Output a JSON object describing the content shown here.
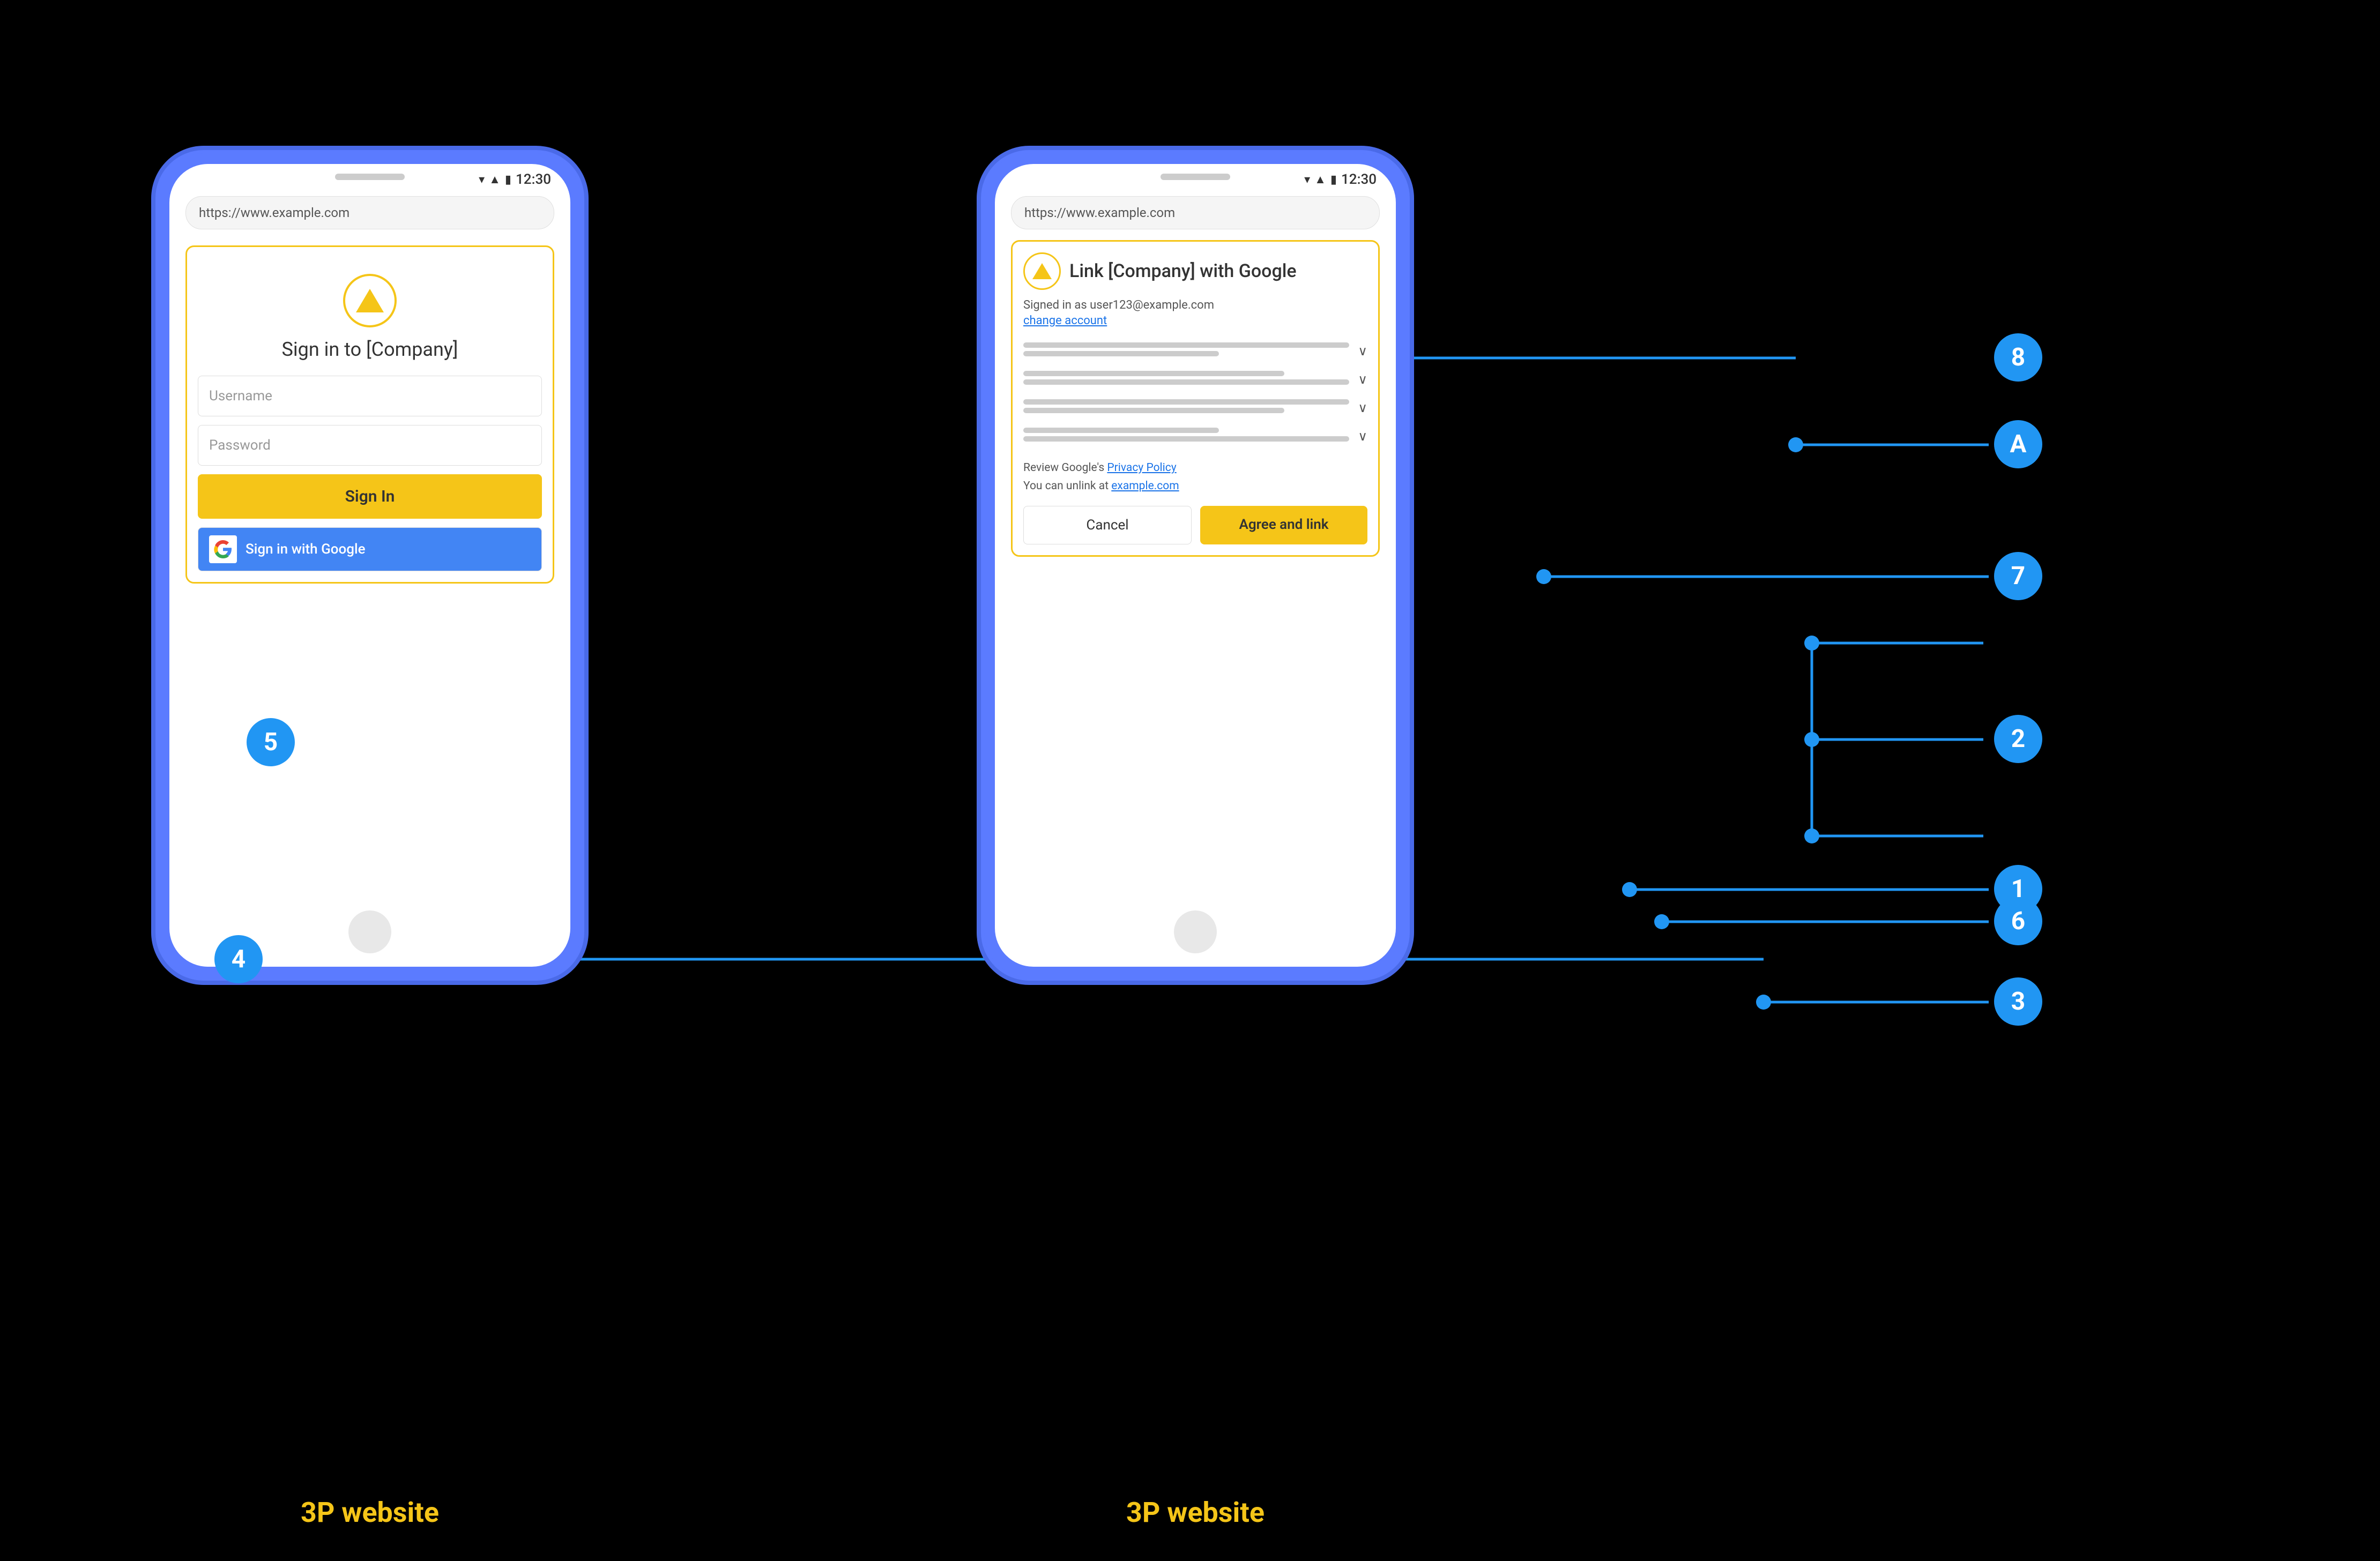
{
  "phone1": {
    "label": "3P website",
    "status": {
      "time": "12:30"
    },
    "url": "https://www.example.com",
    "logo_alt": "company logo triangle",
    "title": "Sign in to [Company]",
    "username_placeholder": "Username",
    "password_placeholder": "Password",
    "sign_in_label": "Sign In",
    "google_btn_label": "Sign in with Google"
  },
  "phone2": {
    "label": "3P website",
    "status": {
      "time": "12:30"
    },
    "url": "https://www.example.com",
    "logo_alt": "company logo triangle small",
    "title": "Link [Company] with Google",
    "signed_in_as": "Signed in as user123@example.com",
    "change_account": "change account",
    "policy_text_1": "Review Google's ",
    "policy_link": "Privacy Policy",
    "policy_text_2": "You can unlink at ",
    "unlink_link": "example.com",
    "cancel_label": "Cancel",
    "agree_label": "Agree and link"
  },
  "annotations": {
    "num1": "1",
    "num2": "2",
    "num3": "3",
    "num4": "4",
    "num5": "5",
    "num6": "6",
    "num7": "7",
    "num8": "8",
    "numA": "A"
  }
}
